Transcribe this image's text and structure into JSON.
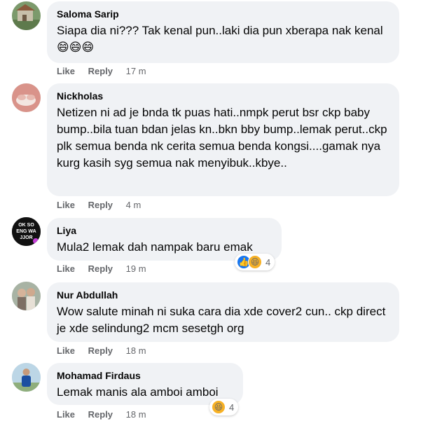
{
  "comments": [
    {
      "author": "Saloma Sarip",
      "text": "Siapa dia ni??? Tak kenal pun..laki dia pun xberapa nak kenal😄😄😄",
      "like_label": "Like",
      "reply_label": "Reply",
      "time": "17 m",
      "avatar_icon": "profile-photo-green-building"
    },
    {
      "author": "Nickholas",
      "text": "Netizen ni ad je bnda tk puas hati..nmpk perut bsr ckp baby bump..bila tuan bdan jelas kn..bkn bby bump..lemak perut..ckp plk semua benda nk cerita semua benda kongsi....gamak nya kurg kasih syg semua nak menyibuk..kbye..",
      "like_label": "Like",
      "reply_label": "Reply",
      "time": "4 m",
      "avatar_icon": "profile-photo-red-hands"
    },
    {
      "author": "Liya",
      "text": "Mula2 lemak dah nampak baru emak",
      "like_label": "Like",
      "reply_label": "Reply",
      "time": "19 m",
      "avatar_icon": "profile-photo-text-logo",
      "avatar_text": "OK SO\nENG WA\nJJOR",
      "reaction_icons": [
        "like-icon",
        "haha-icon"
      ],
      "reaction_count": "4"
    },
    {
      "author": "Nur Abdullah",
      "text": "Wow salute minah ni suka cara dia xde cover2 cun.. ckp direct je xde selindung2 mcm sesetgh org",
      "like_label": "Like",
      "reply_label": "Reply",
      "time": "18 m",
      "avatar_icon": "profile-photo-people"
    },
    {
      "author": "Mohamad Firdaus",
      "text": "Lemak manis ala amboi amboi",
      "like_label": "Like",
      "reply_label": "Reply",
      "time": "18 m",
      "avatar_icon": "profile-photo-blue-figure",
      "reaction_icons": [
        "haha-icon"
      ],
      "reaction_count": "4"
    }
  ],
  "colors": {
    "bubble_bg": "#f0f2f5",
    "text": "#050505",
    "secondary": "#65676b",
    "like_blue": "#1877f2",
    "haha_yellow": "#f7b125"
  }
}
